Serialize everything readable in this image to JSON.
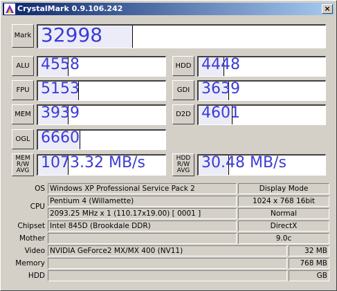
{
  "window": {
    "title": "CrystalMark 0.9.106.242",
    "close_glyph": "×"
  },
  "scores": {
    "mark": {
      "label": "Mark",
      "value": "32998",
      "bar_fraction": 0.33
    },
    "alu": {
      "label": "ALU",
      "value": "4558",
      "bar_fraction": 0.24
    },
    "fpu": {
      "label": "FPU",
      "value": "5153",
      "bar_fraction": 0.32
    },
    "mem": {
      "label": "MEM",
      "value": "3939",
      "bar_fraction": 0.24
    },
    "ogl": {
      "label": "OGL",
      "value": "6660",
      "bar_fraction": 0.33
    },
    "hdd": {
      "label": "HDD",
      "value": "4448",
      "bar_fraction": 0.2
    },
    "gdi": {
      "label": "GDI",
      "value": "3639",
      "bar_fraction": 0.24
    },
    "d2d": {
      "label": "D2D",
      "value": "4601",
      "bar_fraction": 0.27
    },
    "mem_rw": {
      "label_lines": [
        "MEM",
        "R/W",
        "AVG"
      ],
      "value": "1073.32 MB/s",
      "bar_fraction": 0.24
    },
    "hdd_rw": {
      "label_lines": [
        "HDD",
        "R/W",
        "AVG"
      ],
      "value": "30.48 MB/s",
      "bar_fraction": 0.24
    }
  },
  "info": {
    "os": {
      "label": "OS",
      "value": "Windows XP Professional Service Pack 2"
    },
    "display_mode": {
      "label": "Display Mode",
      "value": "1024 x 768 16bit",
      "dpi": "Normal"
    },
    "cpu": {
      "label": "CPU",
      "name": "Pentium 4 (Willamette)",
      "detail": "2093.25 MHz x 1 (110.17x19.00) [ 0001 ]"
    },
    "chipset": {
      "label": "Chipset",
      "value": "Intel 845D (Brookdale DDR)"
    },
    "directx": {
      "label": "DirectX",
      "value": "9.0c"
    },
    "mother": {
      "label": "Mother",
      "value": ""
    },
    "video": {
      "label": "Video",
      "value": "NVIDIA GeForce2 MX/MX 400 (NV11)",
      "memory": "32 MB"
    },
    "memory": {
      "label": "Memory",
      "value": "",
      "size": "768 MB"
    },
    "hdd": {
      "label": "HDD",
      "value": "",
      "size": "GB"
    }
  },
  "colors": {
    "title_start": "#0a246a",
    "title_end": "#a6caf0",
    "score_text": "#3b3bd8",
    "face": "#d4d0c8"
  },
  "icons": {
    "app": "crystalmark-app-icon",
    "close": "close-icon"
  }
}
